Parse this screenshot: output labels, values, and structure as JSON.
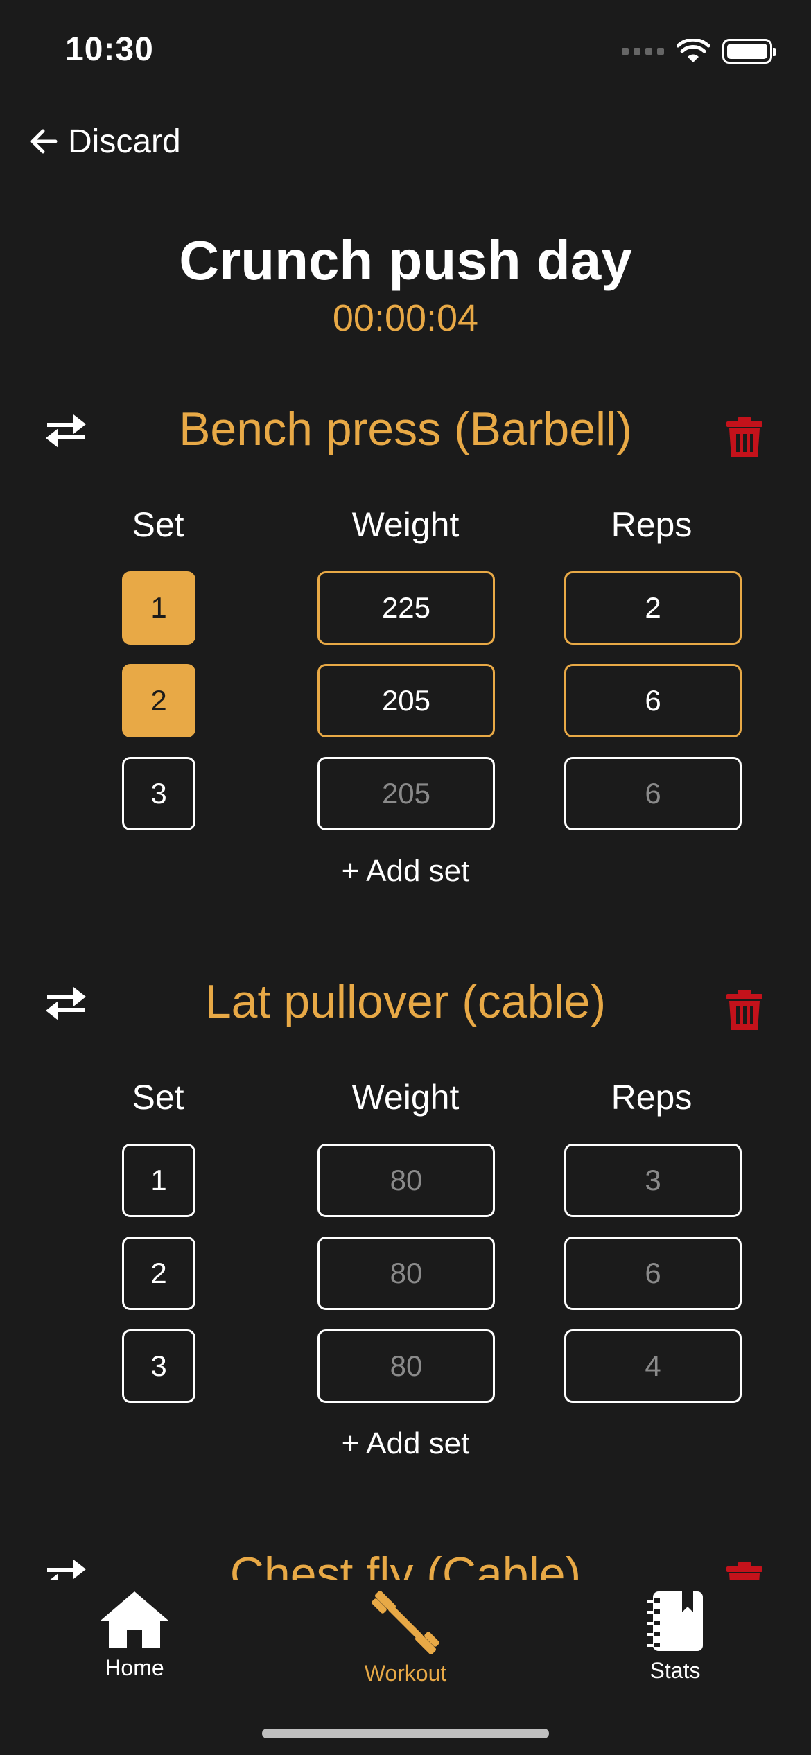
{
  "status_bar": {
    "time": "10:30"
  },
  "nav": {
    "discard_label": "Discard"
  },
  "workout": {
    "title": "Crunch push day",
    "timer": "00:00:04"
  },
  "columns": {
    "set": "Set",
    "weight": "Weight",
    "reps": "Reps"
  },
  "exercises": [
    {
      "name": "Bench press (Barbell)",
      "sets": [
        {
          "set": "1",
          "weight": "225",
          "reps": "2",
          "completed": true
        },
        {
          "set": "2",
          "weight": "205",
          "reps": "6",
          "completed": true
        },
        {
          "set": "3",
          "weight": "205",
          "reps": "6",
          "completed": false
        }
      ],
      "add_set": "+ Add set"
    },
    {
      "name": "Lat pullover (cable)",
      "sets": [
        {
          "set": "1",
          "weight": "80",
          "reps": "3",
          "completed": false
        },
        {
          "set": "2",
          "weight": "80",
          "reps": "6",
          "completed": false
        },
        {
          "set": "3",
          "weight": "80",
          "reps": "4",
          "completed": false
        }
      ],
      "add_set": "+ Add set"
    },
    {
      "name": "Chest fly (Cable)",
      "sets": [],
      "add_set": ""
    }
  ],
  "tabs": [
    {
      "label": "Home",
      "icon": "home-icon",
      "active": false
    },
    {
      "label": "Workout",
      "icon": "dumbbell-icon",
      "active": true
    },
    {
      "label": "Stats",
      "icon": "notebook-icon",
      "active": false
    }
  ],
  "colors": {
    "accent": "#e8a946",
    "danger": "#c4121b",
    "background": "#1b1b1b",
    "placeholder_text": "#8a8a8a"
  }
}
